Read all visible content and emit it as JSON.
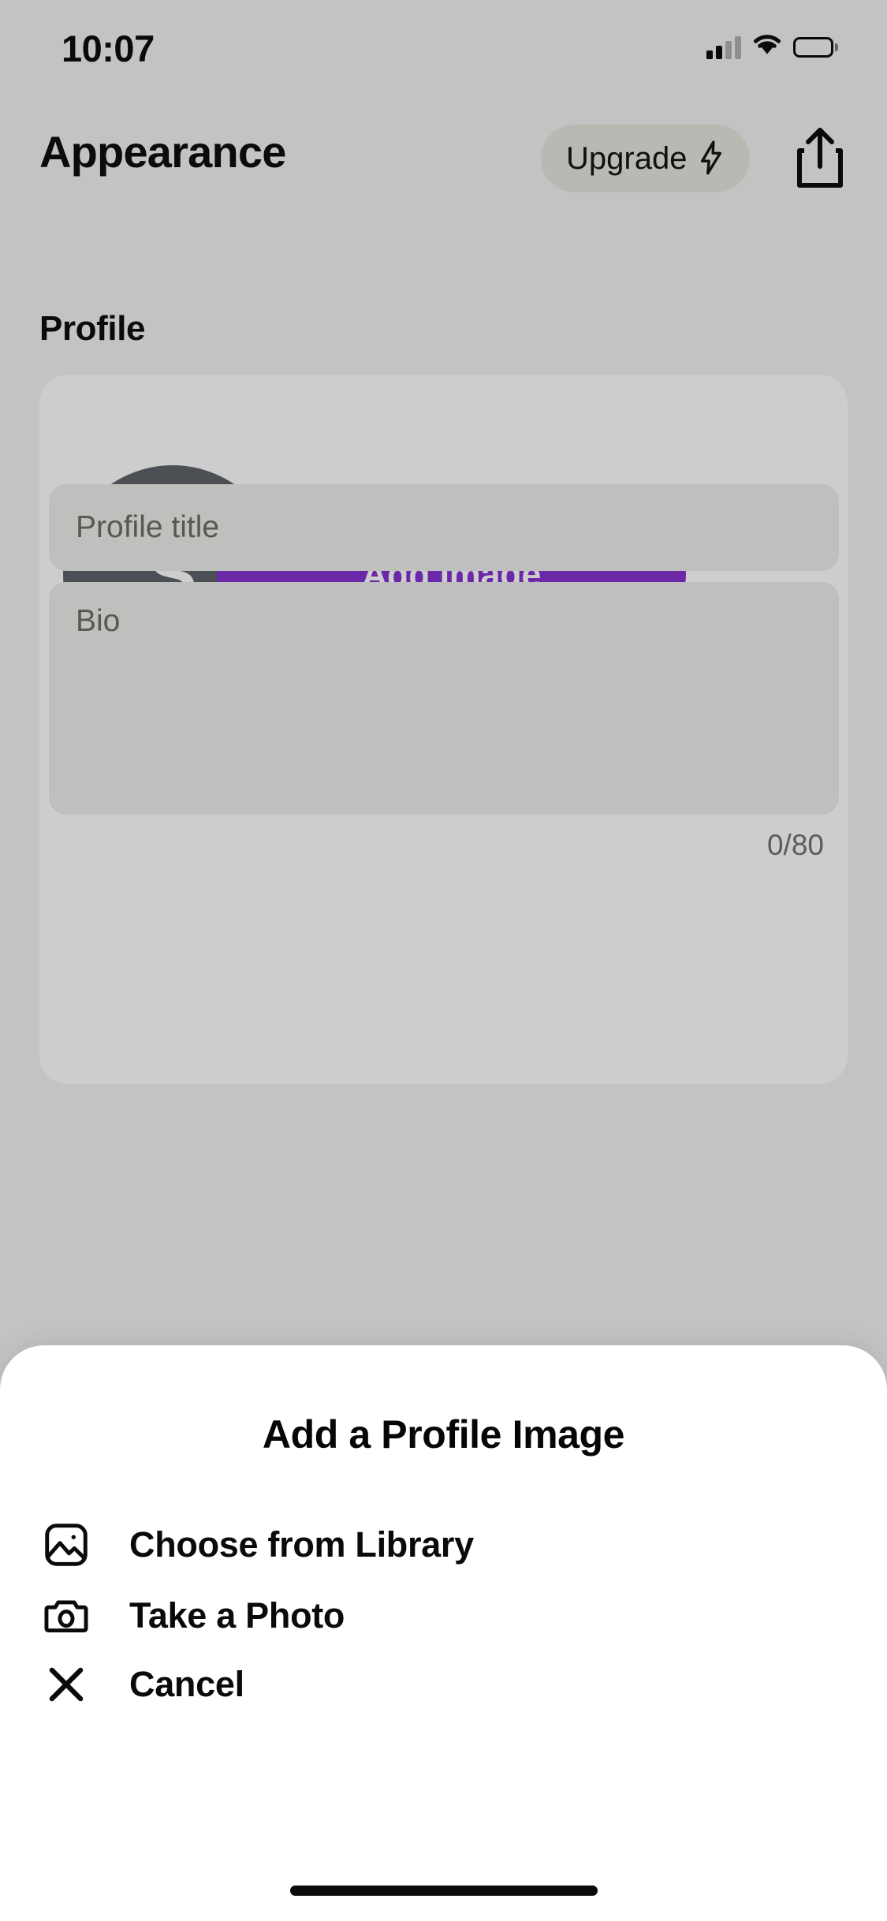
{
  "status_bar": {
    "time": "10:07",
    "cellular_icon": "cellular-signal-icon",
    "wifi_icon": "wifi-icon",
    "battery_icon": "battery-icon"
  },
  "header": {
    "title": "Appearance",
    "upgrade_label": "Upgrade",
    "upgrade_icon": "lightning-bolt-icon",
    "share_icon": "share-icon"
  },
  "main": {
    "section_heading": "Profile",
    "avatar_initial": "S",
    "add_image_label": "Add Image",
    "profile_title_placeholder": "Profile title",
    "profile_title_value": "",
    "bio_placeholder": "Bio",
    "bio_value": "",
    "char_counter": "0/80"
  },
  "action_sheet": {
    "title": "Add a Profile Image",
    "options": [
      {
        "label": "Choose from Library",
        "icon": "photo-library-icon"
      },
      {
        "label": "Take a Photo",
        "icon": "camera-icon"
      },
      {
        "label": "Cancel",
        "icon": "close-x-icon"
      }
    ]
  },
  "colors": {
    "accent_purple": "#6b28a7",
    "app_background": "#c3c3c3",
    "card_background": "#cdcdcd",
    "field_background": "#bfbfbd",
    "avatar_background": "#4c5055",
    "sheet_background": "#ffffff"
  }
}
